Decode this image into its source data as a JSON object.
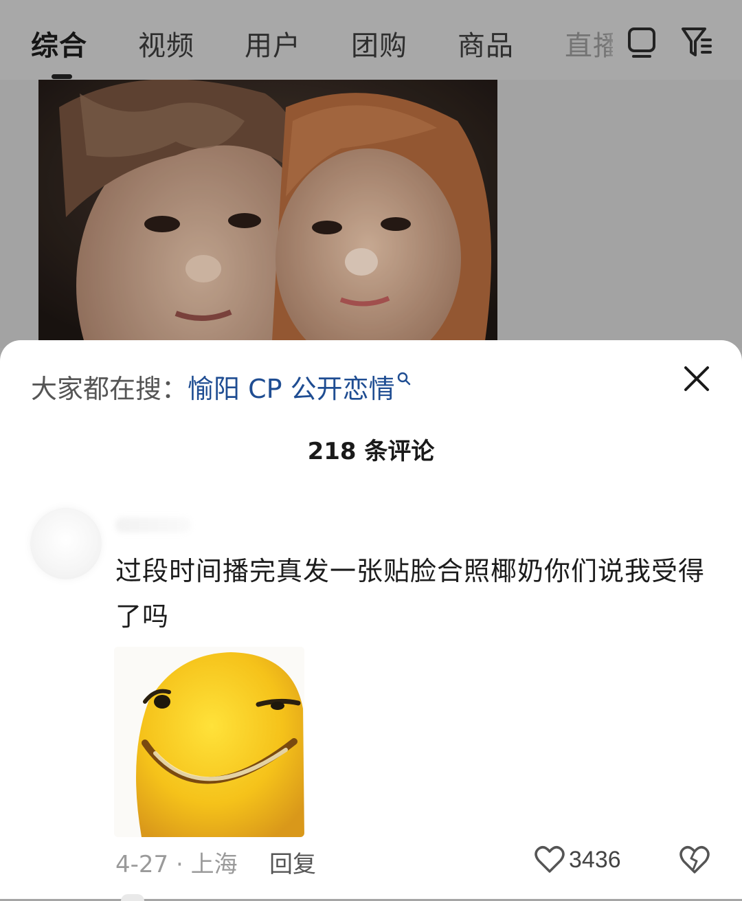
{
  "tabs": [
    {
      "label": "综合",
      "active": true
    },
    {
      "label": "视频",
      "active": false
    },
    {
      "label": "用户",
      "active": false
    },
    {
      "label": "团购",
      "active": false
    },
    {
      "label": "商品",
      "active": false
    },
    {
      "label": "直播",
      "active": false
    }
  ],
  "top_icons": [
    "tv-icon",
    "filter-icon"
  ],
  "comments_sheet": {
    "search_prefix": "大家都在搜：",
    "search_term": "愉阳 CP 公开恋情",
    "count_label": "218 条评论",
    "comment": {
      "text": "过段时间播完真发一张贴脸合照椰奶你们说我受得了吗",
      "date_location": "4-27 · 上海",
      "reply_label": "回复",
      "like_count": "3436",
      "sticker": "yellow-smiling-creature-sticker"
    }
  },
  "colors": {
    "accent_link": "#1f4d92",
    "overlay_dim": "#a5a5a5",
    "sticker_yellow": "#f5c21a"
  }
}
